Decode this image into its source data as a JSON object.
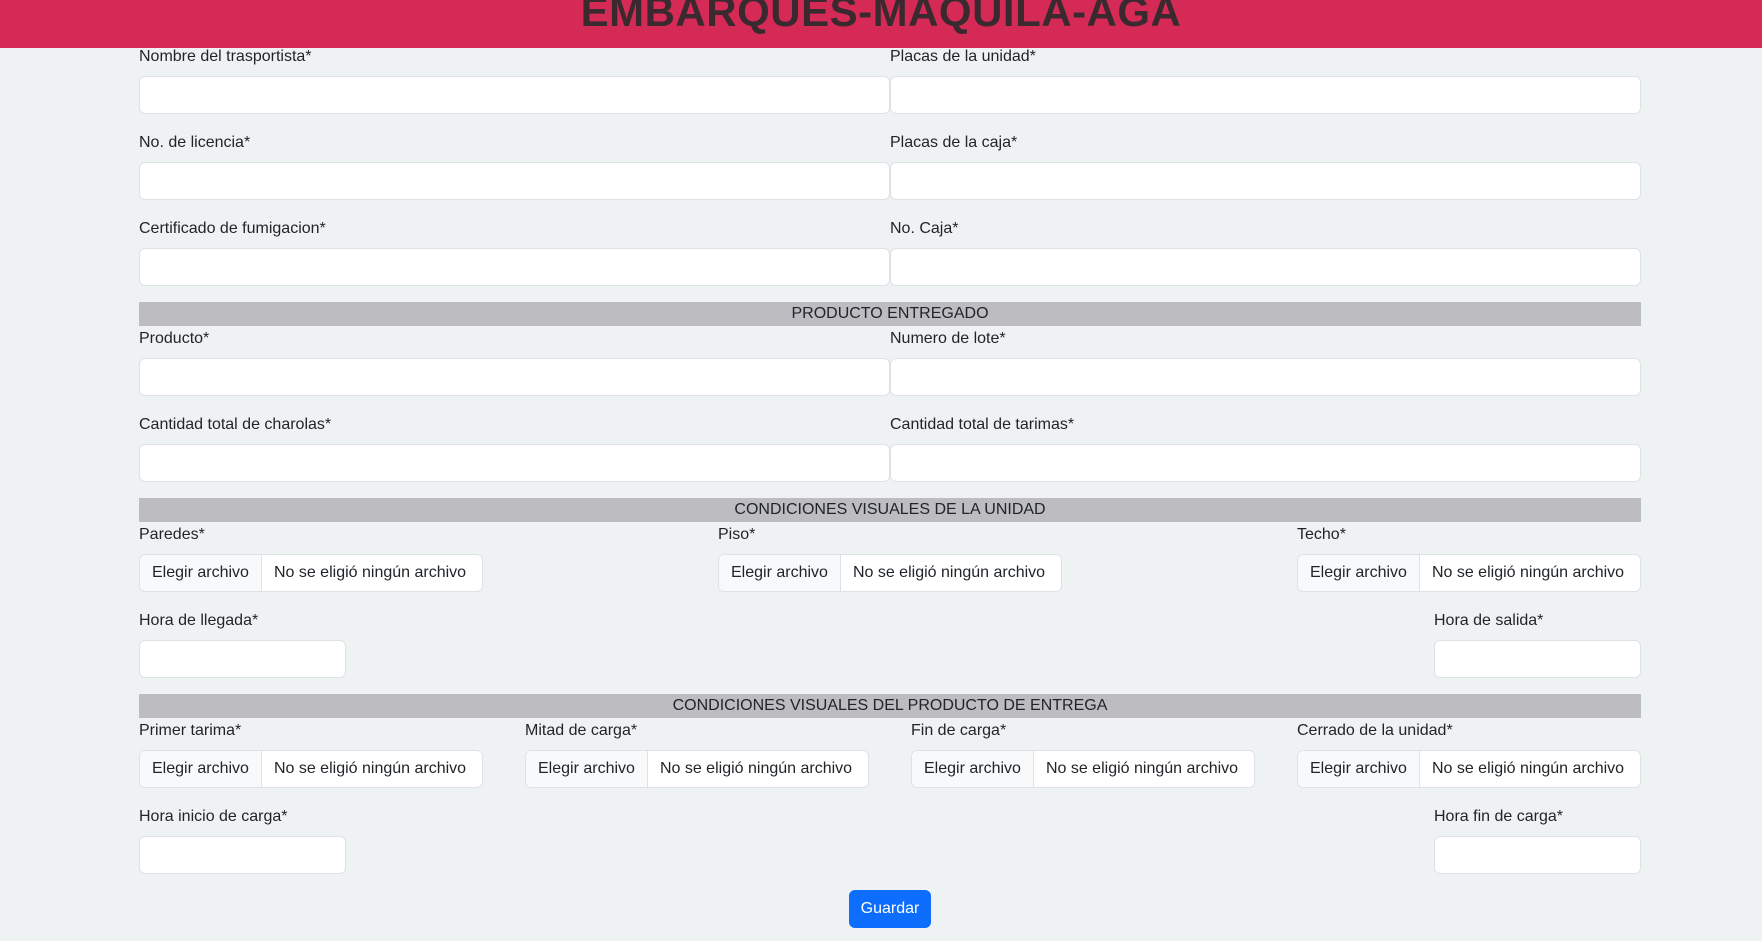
{
  "header": {
    "title": "EMBARQUES-MAQUILA-AGA"
  },
  "transport": {
    "carrier_name_label": "Nombre del trasportista*",
    "unit_plates_label": "Placas de la unidad*",
    "license_label": "No. de licencia*",
    "box_plates_label": "Placas de la caja*",
    "fumigation_label": "Certificado de fumigacion*",
    "box_number_label": "No. Caja*"
  },
  "product_section": {
    "title": "PRODUCTO ENTREGADO",
    "product_label": "Producto*",
    "lot_label": "Numero de lote*",
    "trays_label": "Cantidad total de charolas*",
    "pallets_label": "Cantidad total de tarimas*"
  },
  "unit_conditions": {
    "title": "CONDICIONES VISUALES DE LA UNIDAD",
    "walls_label": "Paredes*",
    "floor_label": "Piso*",
    "roof_label": "Techo*",
    "arrival_label": "Hora de llegada*",
    "departure_label": "Hora de salida*"
  },
  "product_conditions": {
    "title": "CONDICIONES VISUALES DEL PRODUCTO DE ENTREGA",
    "first_pallet_label": "Primer tarima*",
    "mid_load_label": "Mitad de carga*",
    "end_load_label": "Fin de carga*",
    "unit_closed_label": "Cerrado de la unidad*",
    "load_start_label": "Hora inicio de carga*",
    "load_end_label": "Hora fin de carga*"
  },
  "file_input": {
    "button_label": "Elegir archivo",
    "empty_text": "No se eligió ningún archivo"
  },
  "actions": {
    "save_label": "Guardar"
  }
}
